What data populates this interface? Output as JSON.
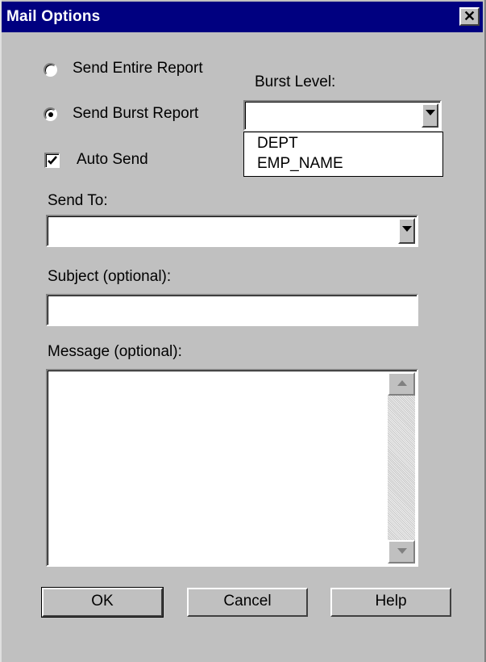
{
  "window": {
    "title": "Mail Options",
    "close_glyph": "✕"
  },
  "send_mode": {
    "entire_label": "Send Entire Report",
    "burst_label": "Send Burst Report",
    "selected": "burst"
  },
  "auto_send": {
    "label": "Auto Send",
    "checked": true
  },
  "burst_level": {
    "label": "Burst Level:",
    "value": "",
    "options": [
      "DEPT",
      "EMP_NAME"
    ]
  },
  "send_to": {
    "label": "Send To:",
    "value": ""
  },
  "subject": {
    "label": "Subject (optional):",
    "value": ""
  },
  "message": {
    "label": "Message (optional):",
    "value": ""
  },
  "buttons": {
    "ok": "OK",
    "cancel": "Cancel",
    "help": "Help"
  },
  "icons": {
    "close": "close-icon",
    "dropdown": "chevron-down-icon",
    "scroll_up": "scroll-up-arrow-icon",
    "scroll_down": "scroll-down-arrow-icon",
    "check": "checkmark-icon"
  }
}
